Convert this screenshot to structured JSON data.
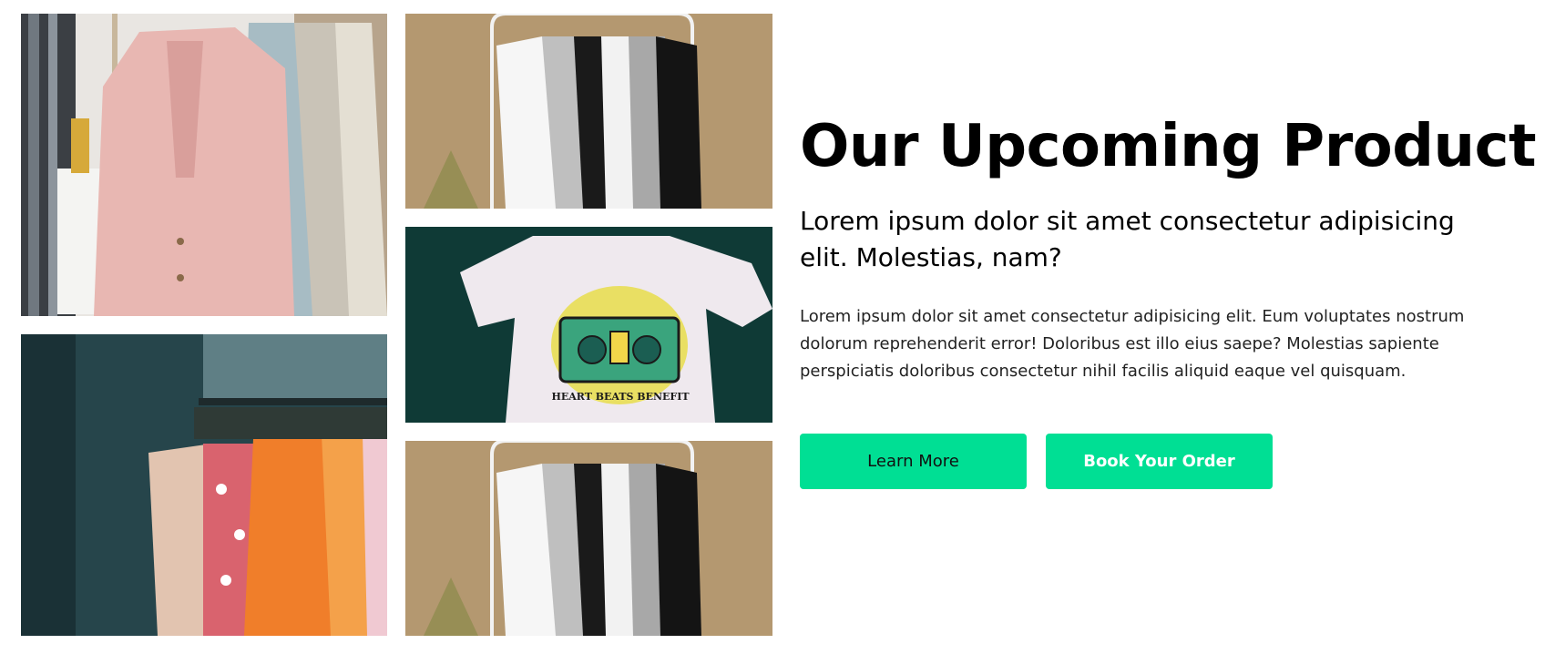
{
  "gallery": {
    "images": [
      {
        "id": "pink-blazer-rack",
        "alt": "Pink blazer hanging on a rack"
      },
      {
        "id": "colorful-clothes-rack",
        "alt": "Rack of colorful clothes"
      },
      {
        "id": "tshirt-rack-top",
        "alt": "Rack of white, grey and black t-shirts"
      },
      {
        "id": "heart-beats-tshirt",
        "alt": "White t-shirt with boombox print"
      },
      {
        "id": "tshirt-rack-bottom",
        "alt": "Rack of white, grey and black t-shirts"
      }
    ],
    "tshirt_print_text": "HEART BEATS BENEFIT"
  },
  "hero": {
    "headline": "Our Upcoming Product",
    "subtitle": "Lorem ipsum dolor sit amet consectetur adipisicing elit. Molestias, nam?",
    "body": "Lorem ipsum dolor sit amet consectetur adipisicing elit. Eum voluptates nostrum dolorum reprehenderit error! Doloribus est illo eius saepe? Molestias sapiente perspiciatis doloribus consectetur nihil facilis aliquid eaque vel quisquam.",
    "buttons": {
      "learn_more": "Learn More",
      "book_order": "Book Your Order"
    }
  },
  "colors": {
    "accent": "#00df94",
    "text": "#000000",
    "background": "#ffffff"
  }
}
